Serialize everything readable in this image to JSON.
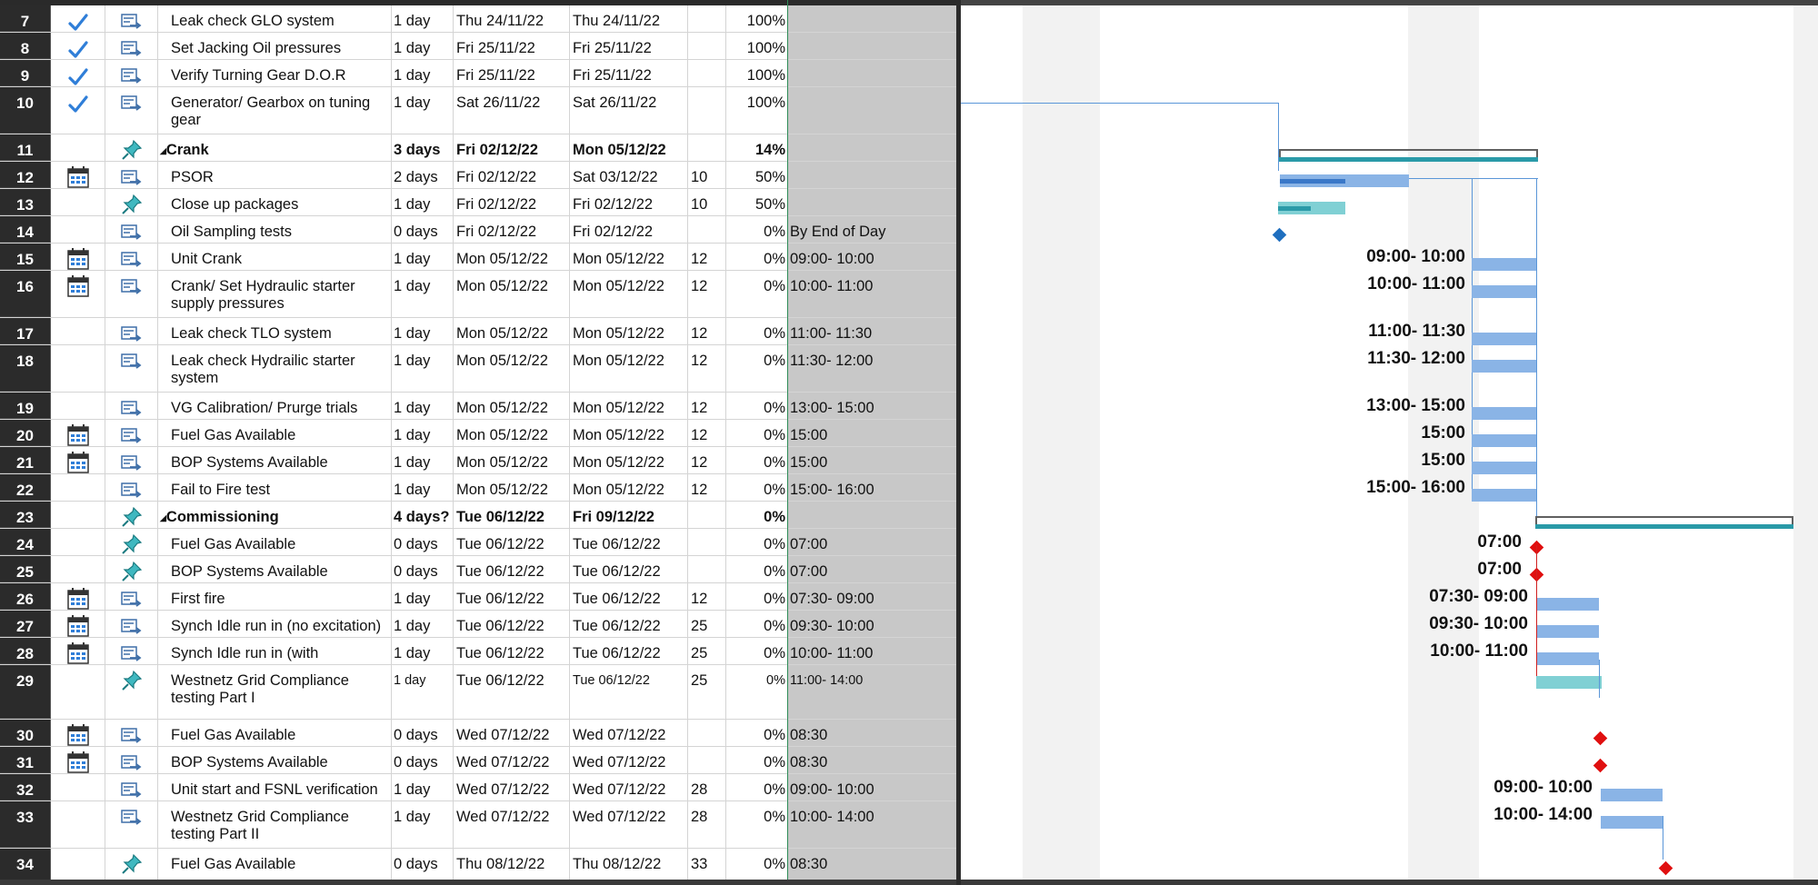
{
  "rows": [
    {
      "id": "7",
      "indicator": "check",
      "mode": "auto",
      "name": "Leak check GLO system",
      "duration": "1 day",
      "start": "Thu 24/11/22",
      "finish": "Thu 24/11/22",
      "pred": "",
      "pct": "100%",
      "text": ""
    },
    {
      "id": "8",
      "indicator": "check",
      "mode": "auto",
      "name": "Set Jacking Oil pressures",
      "duration": "1 day",
      "start": "Fri 25/11/22",
      "finish": "Fri 25/11/22",
      "pred": "",
      "pct": "100%",
      "text": ""
    },
    {
      "id": "9",
      "indicator": "check",
      "mode": "auto",
      "name": "Verify Turning Gear D.O.R",
      "duration": "1 day",
      "start": "Fri 25/11/22",
      "finish": "Fri 25/11/22",
      "pred": "",
      "pct": "100%",
      "text": ""
    },
    {
      "id": "10",
      "indicator": "check",
      "mode": "auto",
      "name": "Generator/ Gearbox on tuning gear",
      "duration": "1 day",
      "start": "Sat 26/11/22",
      "finish": "Sat 26/11/22",
      "pred": "",
      "pct": "100%",
      "text": ""
    },
    {
      "id": "11",
      "indicator": "",
      "mode": "manual",
      "name": "Crank",
      "duration": "3 days",
      "start": "Fri 02/12/22",
      "finish": "Mon 05/12/22",
      "pred": "",
      "pct": "14%",
      "text": "",
      "summary": true
    },
    {
      "id": "12",
      "indicator": "calendar",
      "mode": "auto",
      "name": "PSOR",
      "duration": "2 days",
      "start": "Fri 02/12/22",
      "finish": "Sat 03/12/22",
      "pred": "10",
      "pct": "50%",
      "text": ""
    },
    {
      "id": "13",
      "indicator": "",
      "mode": "manual",
      "name": "Close up packages",
      "duration": "1 day",
      "start": "Fri 02/12/22",
      "finish": "Fri 02/12/22",
      "pred": "10",
      "pct": "50%",
      "text": ""
    },
    {
      "id": "14",
      "indicator": "",
      "mode": "auto",
      "name": "Oil Sampling tests",
      "duration": "0 days",
      "start": "Fri 02/12/22",
      "finish": "Fri 02/12/22",
      "pred": "",
      "pct": "0%",
      "text": "By End of Day"
    },
    {
      "id": "15",
      "indicator": "calendar",
      "mode": "auto",
      "name": "Unit Crank",
      "duration": "1 day",
      "start": "Mon 05/12/22",
      "finish": "Mon 05/12/22",
      "pred": "12",
      "pct": "0%",
      "text": "09:00- 10:00"
    },
    {
      "id": "16",
      "indicator": "calendar",
      "mode": "auto",
      "name": "Crank/ Set Hydraulic starter supply pressures",
      "duration": "1 day",
      "start": "Mon 05/12/22",
      "finish": "Mon 05/12/22",
      "pred": "12",
      "pct": "0%",
      "text": "10:00- 11:00"
    },
    {
      "id": "17",
      "indicator": "",
      "mode": "auto",
      "name": "Leak check TLO system",
      "duration": "1 day",
      "start": "Mon 05/12/22",
      "finish": "Mon 05/12/22",
      "pred": "12",
      "pct": "0%",
      "text": "11:00- 11:30"
    },
    {
      "id": "18",
      "indicator": "",
      "mode": "auto",
      "name": "Leak check Hydrailic starter system",
      "duration": "1 day",
      "start": "Mon 05/12/22",
      "finish": "Mon 05/12/22",
      "pred": "12",
      "pct": "0%",
      "text": "11:30- 12:00"
    },
    {
      "id": "19",
      "indicator": "",
      "mode": "auto",
      "name": "VG Calibration/ Prurge trials",
      "duration": "1 day",
      "start": "Mon 05/12/22",
      "finish": "Mon 05/12/22",
      "pred": "12",
      "pct": "0%",
      "text": "13:00- 15:00"
    },
    {
      "id": "20",
      "indicator": "calendar",
      "mode": "auto",
      "name": "Fuel Gas Available",
      "duration": "1 day",
      "start": "Mon 05/12/22",
      "finish": "Mon 05/12/22",
      "pred": "12",
      "pct": "0%",
      "text": "15:00"
    },
    {
      "id": "21",
      "indicator": "calendar",
      "mode": "auto",
      "name": "BOP Systems Available",
      "duration": "1 day",
      "start": "Mon 05/12/22",
      "finish": "Mon 05/12/22",
      "pred": "12",
      "pct": "0%",
      "text": "15:00"
    },
    {
      "id": "22",
      "indicator": "",
      "mode": "auto",
      "name": "Fail to Fire test",
      "duration": "1 day",
      "start": "Mon 05/12/22",
      "finish": "Mon 05/12/22",
      "pred": "12",
      "pct": "0%",
      "text": "15:00- 16:00"
    },
    {
      "id": "23",
      "indicator": "",
      "mode": "manual",
      "name": "Commissioning",
      "duration": "4 days?",
      "start": "Tue 06/12/22",
      "finish": "Fri 09/12/22",
      "pred": "",
      "pct": "0%",
      "text": "",
      "summary": true
    },
    {
      "id": "24",
      "indicator": "",
      "mode": "manual",
      "name": "Fuel Gas Available",
      "duration": "0 days",
      "start": "Tue 06/12/22",
      "finish": "Tue 06/12/22",
      "pred": "",
      "pct": "0%",
      "text": "07:00"
    },
    {
      "id": "25",
      "indicator": "",
      "mode": "manual",
      "name": "BOP Systems Available",
      "duration": "0 days",
      "start": "Tue 06/12/22",
      "finish": "Tue 06/12/22",
      "pred": "",
      "pct": "0%",
      "text": "07:00"
    },
    {
      "id": "26",
      "indicator": "calendar",
      "mode": "auto",
      "name": "First fire",
      "duration": "1 day",
      "start": "Tue 06/12/22",
      "finish": "Tue 06/12/22",
      "pred": "12",
      "pct": "0%",
      "text": "07:30- 09:00"
    },
    {
      "id": "27",
      "indicator": "calendar",
      "mode": "auto",
      "name": "Synch Idle run in (no excitation)",
      "duration": "1 day",
      "start": "Tue 06/12/22",
      "finish": "Tue 06/12/22",
      "pred": "25",
      "pct": "0%",
      "text": "09:30- 10:00"
    },
    {
      "id": "28",
      "indicator": "calendar",
      "mode": "auto",
      "name": "Synch Idle run in (with excitation)",
      "duration": "1 day",
      "start": "Tue 06/12/22",
      "finish": "Tue 06/12/22",
      "pred": "25",
      "pct": "0%",
      "text": "10:00- 11:00"
    },
    {
      "id": "29",
      "indicator": "",
      "mode": "manual",
      "name": "Westnetz Grid Compliance testing Part I",
      "duration": "1 day",
      "start": "Tue 06/12/22",
      "finish": "Tue 06/12/22",
      "pred": "25",
      "pct": "0%",
      "text": "11:00- 14:00",
      "small": true
    },
    {
      "id": "30",
      "indicator": "calendar",
      "mode": "auto",
      "name": "Fuel Gas Available",
      "duration": "0 days",
      "start": "Wed 07/12/22",
      "finish": "Wed 07/12/22",
      "pred": "",
      "pct": "0%",
      "text": "08:30"
    },
    {
      "id": "31",
      "indicator": "calendar",
      "mode": "auto",
      "name": "BOP Systems Available",
      "duration": "0 days",
      "start": "Wed 07/12/22",
      "finish": "Wed 07/12/22",
      "pred": "",
      "pct": "0%",
      "text": "08:30"
    },
    {
      "id": "32",
      "indicator": "",
      "mode": "auto",
      "name": "Unit start and FSNL verification",
      "duration": "1 day",
      "start": "Wed 07/12/22",
      "finish": "Wed 07/12/22",
      "pred": "28",
      "pct": "0%",
      "text": "09:00- 10:00"
    },
    {
      "id": "33",
      "indicator": "",
      "mode": "auto",
      "name": "Westnetz Grid Compliance testing Part II",
      "duration": "1 day",
      "start": "Wed 07/12/22",
      "finish": "Wed 07/12/22",
      "pred": "28",
      "pct": "0%",
      "text": "10:00- 14:00"
    },
    {
      "id": "34",
      "indicator": "",
      "mode": "manual",
      "name": "Fuel Gas Available",
      "duration": "0 days",
      "start": "Thu 08/12/22",
      "finish": "Thu 08/12/22",
      "pred": "33",
      "pct": "0%",
      "text": "08:30"
    }
  ],
  "colors": {
    "auto_bar": "#8ab4e6",
    "manual_bar": "#80d0d4",
    "milestone_critical": "#e01010",
    "milestone": "#1f6fbf",
    "summary": "#2a9aa8"
  }
}
